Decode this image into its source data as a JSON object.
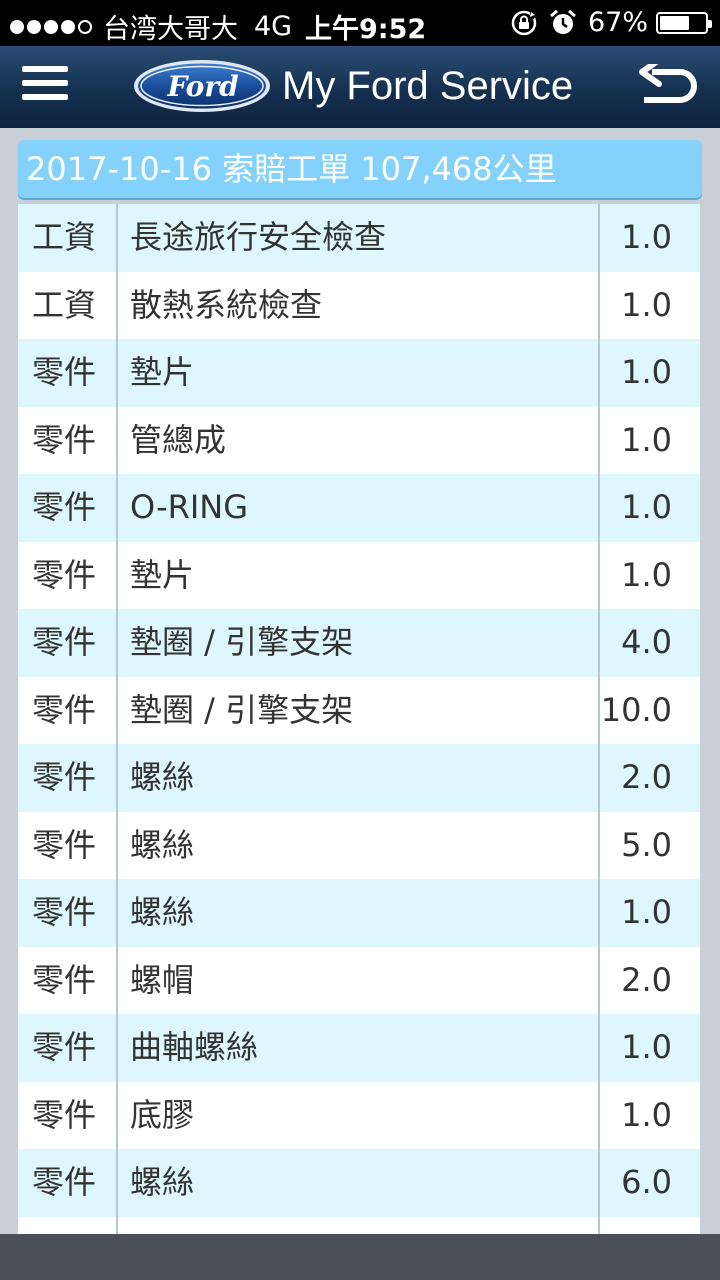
{
  "status_bar": {
    "carrier": "台湾大哥大",
    "network": "4G",
    "time": "上午9:52",
    "battery_percent": "67%",
    "battery_level": 0.67,
    "signal_bars_filled": 4,
    "icons": [
      "rotation-lock-icon",
      "alarm-icon",
      "battery-icon"
    ]
  },
  "nav": {
    "logo_text": "Ford",
    "title": "My Ford Service",
    "menu_icon": "hamburger-menu-icon",
    "back_icon": "back-arrow-icon"
  },
  "record": {
    "header": "2017-10-16 索賠工單 107,468公里"
  },
  "items": [
    {
      "type": "工資",
      "desc": "長途旅行安全檢查",
      "qty": "1.0"
    },
    {
      "type": "工資",
      "desc": "散熱系統檢查",
      "qty": "1.0"
    },
    {
      "type": "零件",
      "desc": "墊片",
      "qty": "1.0"
    },
    {
      "type": "零件",
      "desc": "管總成",
      "qty": "1.0"
    },
    {
      "type": "零件",
      "desc": "O-RING",
      "qty": "1.0"
    },
    {
      "type": "零件",
      "desc": "墊片",
      "qty": "1.0"
    },
    {
      "type": "零件",
      "desc": "墊圈 / 引擎支架",
      "qty": "4.0"
    },
    {
      "type": "零件",
      "desc": "墊圈 / 引擎支架",
      "qty": "10.0"
    },
    {
      "type": "零件",
      "desc": "螺絲",
      "qty": "2.0"
    },
    {
      "type": "零件",
      "desc": "螺絲",
      "qty": "5.0"
    },
    {
      "type": "零件",
      "desc": "螺絲",
      "qty": "1.0"
    },
    {
      "type": "零件",
      "desc": "螺帽",
      "qty": "2.0"
    },
    {
      "type": "零件",
      "desc": "曲軸螺絲",
      "qty": "1.0"
    },
    {
      "type": "零件",
      "desc": "底膠",
      "qty": "1.0"
    },
    {
      "type": "零件",
      "desc": "螺絲",
      "qty": "6.0"
    },
    {
      "type": "",
      "desc": "",
      "qty": ""
    }
  ],
  "colors": {
    "nav_bg": "#14304f",
    "header_bg": "#84d2fb",
    "row_alt": "#def6fe",
    "row_plain": "#ffffff",
    "bottom_bar": "#4a5058"
  }
}
